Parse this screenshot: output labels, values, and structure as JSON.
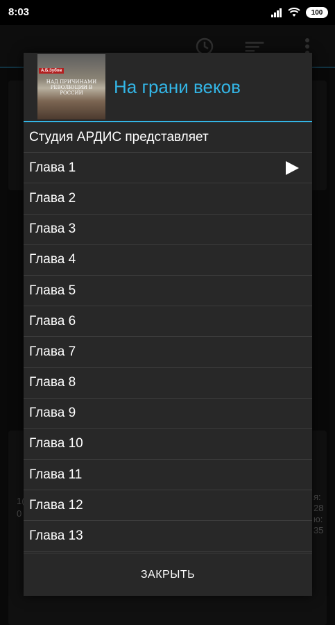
{
  "status_bar": {
    "time": "8:03",
    "battery": "100"
  },
  "background": {
    "side_text_left_1": "1(",
    "side_text_left_2": "0",
    "side_text_right_1": "я:",
    "side_text_right_2": "28",
    "side_text_right_3": "ю:",
    "side_text_right_4": "35"
  },
  "dialog": {
    "title": "На грани веков",
    "cover": {
      "author_label": "А.Б.Зубов",
      "title_text": "НАД ПРИЧИНАМИ РЕВОЛЮЦИИ В РОССИИ"
    },
    "items": [
      {
        "label": "Студия АРДИС представляет",
        "playing": false
      },
      {
        "label": "Глава 1",
        "playing": true
      },
      {
        "label": "Глава 2",
        "playing": false
      },
      {
        "label": "Глава 3",
        "playing": false
      },
      {
        "label": "Глава 4",
        "playing": false
      },
      {
        "label": "Глава 5",
        "playing": false
      },
      {
        "label": "Глава 6",
        "playing": false
      },
      {
        "label": "Глава 7",
        "playing": false
      },
      {
        "label": "Глава 8",
        "playing": false
      },
      {
        "label": "Глава 9",
        "playing": false
      },
      {
        "label": "Глава 10",
        "playing": false
      },
      {
        "label": "Глава 11",
        "playing": false
      },
      {
        "label": "Глава 12",
        "playing": false
      },
      {
        "label": "Глава 13",
        "playing": false
      }
    ],
    "close_label": "ЗАКРЫТЬ"
  },
  "colors": {
    "accent": "#33b5e5",
    "dialog_bg": "#282828",
    "divider": "#3c3c3c"
  },
  "icons": {
    "playing_indicator": "play-icon"
  }
}
